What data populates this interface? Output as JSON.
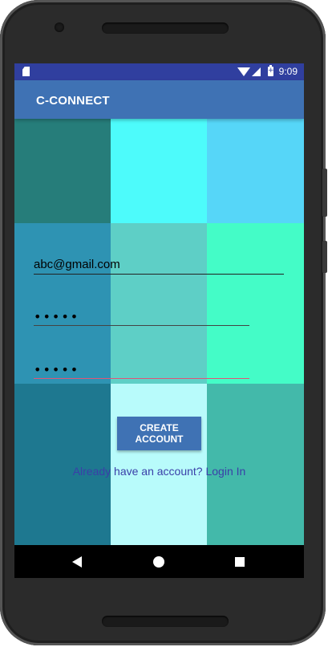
{
  "statusbar": {
    "time": "9:09",
    "icons": [
      "sd-card-icon",
      "wifi-icon",
      "cell-signal-icon",
      "battery-icon"
    ]
  },
  "appbar": {
    "title": "C-CONNECT"
  },
  "form": {
    "email_value": "abc@gmail.com",
    "password_value": "•••••",
    "confirm_password_value": "•••••",
    "create_button_label": "CREATE ACCOUNT"
  },
  "login_prompt": {
    "text": "Already have an account? ",
    "link_label": "Login In"
  },
  "navbar": {
    "icons": [
      "back-icon",
      "home-icon",
      "recents-icon"
    ]
  },
  "colors": {
    "statusbar": "#303f9f",
    "appbar": "#3f72b4",
    "tiles": [
      "#267d7a",
      "#4dfbfb",
      "#56d6f8",
      "#2e93b3",
      "#5ecfc6",
      "#44fcc7",
      "#1e7890",
      "#b8fbfb",
      "#43b9aa"
    ],
    "link": "#3a3fa8",
    "confirm_underline": "#e05577"
  }
}
